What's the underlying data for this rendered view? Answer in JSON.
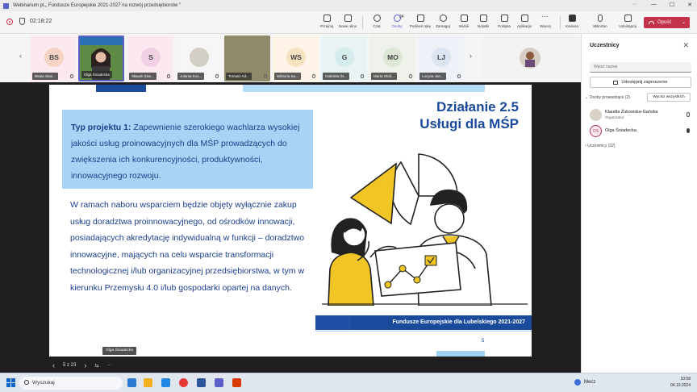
{
  "window": {
    "title": "Webinarium pt.„ Fundusze Europejskie 2021-2027 na rozwój przedsiębiorstw ”",
    "more": "···",
    "minimize": "—",
    "maximize": "☐",
    "close": "✕"
  },
  "toolbar": {
    "timer": "02:18:22",
    "buttons": [
      {
        "label": "Przejmij"
      },
      {
        "label": "Nowe okno"
      },
      {
        "label": "Czat"
      },
      {
        "label": "Osoby",
        "count": "34"
      },
      {
        "label": "Podnieś rękę"
      },
      {
        "label": "Zareaguj"
      },
      {
        "label": "Widok"
      },
      {
        "label": "Notatki"
      },
      {
        "label": "Polityka"
      },
      {
        "label": "Aplikacje"
      },
      {
        "label": "Więcej"
      },
      {
        "label": "Kamera"
      },
      {
        "label": "Mikrofon"
      },
      {
        "label": "Udostępnij"
      }
    ],
    "leave_label": "Opuść"
  },
  "participants": [
    {
      "initials": "BS",
      "name": "Beata Stas...",
      "color": "#fbe9ef",
      "avatar_color": "#f6d3c2"
    },
    {
      "initials": "",
      "name": "Olga Śniadecka",
      "color": "#6b8e4e",
      "avatar_color": "#6b8e4e"
    },
    {
      "initials": "S",
      "name": "Sławek (Nie...",
      "color": "#fbe9ef",
      "avatar_color": "#f1d0e4"
    },
    {
      "initials": "",
      "name": "Jolanta Kos...",
      "color": "#fbe9ef",
      "avatar_color": "#d3cfc6"
    },
    {
      "initials": "",
      "name": "Tomasz Ad...",
      "color": "#8f8a6a",
      "avatar_color": "#8f8a6a"
    },
    {
      "initials": "WS",
      "name": "Wiktoria Sa...",
      "color": "#fbe9ef",
      "avatar_color": "#f7e2c0"
    },
    {
      "initials": "G",
      "name": "Gabriela (N...",
      "color": "#eaf3f3",
      "avatar_color": "#d4ecec"
    },
    {
      "initials": "MO",
      "name": "Marta Okól...",
      "color": "#eef2ea",
      "avatar_color": "#dde7d6"
    },
    {
      "initials": "LJ",
      "name": "Lucyna Jan...",
      "color": "#eef1f8",
      "avatar_color": "#dbe4f3"
    }
  ],
  "slide": {
    "box_strong": "Typ projektu 1:",
    "box_text": " Zapewnienie szerokiego wachlarza wysokiej jakości usług proinowacyjnych dla MŚP prowadzących do zwiększenia ich konkurencyjności, produktywności, innowacyjnego rozwoju.",
    "body": "W ramach naboru wsparciem będzie objęty wyłącznie zakup usług doradztwa proinnowacyjnego, od ośrodków innowacji, posiadających akredytację indywidualną w funkcji – doradztwo innowacyjne, mających na celu wsparcie transformacji technologicznej i/lub organizacyjnej przedsiębiorstwa, w tym w kierunku Przemysłu 4.0 i/lub gospodarki opartej na danych.",
    "heading_line1": "Działanie 2.5",
    "heading_line2": "Usługi dla MŚP",
    "footer": "Fundusze Europejskie dla Lubelskiego 2021-2027",
    "page": "5"
  },
  "presenter": "Olga Śniadecka",
  "slide_nav": {
    "position": "5 z 23",
    "more": "···"
  },
  "panel": {
    "title": "Uczestnicy",
    "close": "✕",
    "search_placeholder": "Wpisz nazwę",
    "invite": "Udostępnij zaproszenie",
    "organizers_section": "Osoby prowadzące (2)",
    "mute_all": "Wycisz wszystkich",
    "people": [
      {
        "name": "Klaudia Żukowska-Gańska",
        "role": "Organizator",
        "initials": ""
      },
      {
        "name": "Olga Śniadecka",
        "role": "",
        "initials": "OS"
      }
    ],
    "attendees_section": "Uczestnicy (32)"
  },
  "taskbar": {
    "search": "Wyszukaj",
    "weather": "Mecz",
    "time": "10:58",
    "date": "04.10.2024"
  },
  "colors": {
    "accent": "#5b5fc7",
    "leave": "#c4314b",
    "slide_blue": "#1a4a9c",
    "slide_light": "#a9d3f5",
    "illustration_yellow": "#f2c526"
  }
}
